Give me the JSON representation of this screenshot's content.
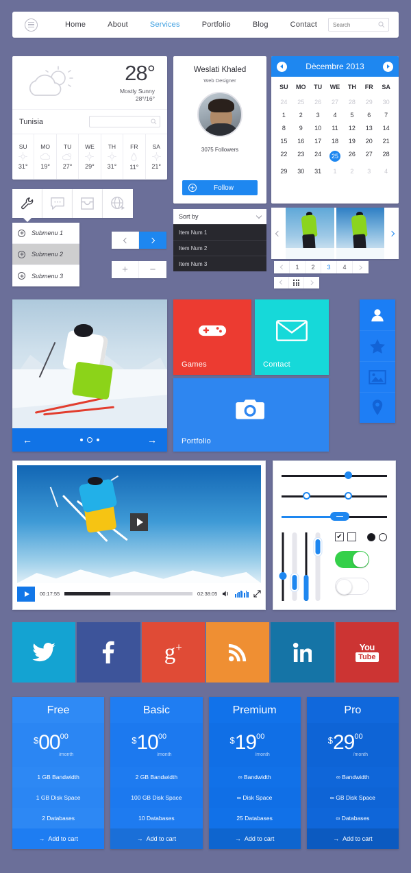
{
  "navbar": {
    "menu_icon": "hamburger-icon",
    "links": [
      {
        "label": "Home",
        "active": false
      },
      {
        "label": "About",
        "active": false
      },
      {
        "label": "Services",
        "active": true
      },
      {
        "label": "Portfolio",
        "active": false
      },
      {
        "label": "Blog",
        "active": false
      },
      {
        "label": "Contact",
        "active": false
      }
    ],
    "search_placeholder": "Search",
    "search_value": ""
  },
  "weather": {
    "icon": "sun-behind-cloud-icon",
    "temperature": "28°",
    "condition": "Mostly Sunny",
    "range": "28°/16°",
    "location": "Tunisia",
    "search_placeholder": "",
    "days": [
      {
        "day": "SU",
        "icon": "sun-icon",
        "temp": "31°"
      },
      {
        "day": "MO",
        "icon": "cloud-icon",
        "temp": "19°"
      },
      {
        "day": "TU",
        "icon": "sun-cloud-icon",
        "temp": "27°"
      },
      {
        "day": "WE",
        "icon": "sun-icon",
        "temp": "29°"
      },
      {
        "day": "TH",
        "icon": "sun-icon",
        "temp": "31°"
      },
      {
        "day": "FR",
        "icon": "raindrop-icon",
        "temp": "11°"
      },
      {
        "day": "SA",
        "icon": "sun-icon",
        "temp": "21°"
      }
    ]
  },
  "profile": {
    "name": "Weslati Khaled",
    "role": "Web Designer",
    "followers": "3075 Followers",
    "follow_label": "Follow",
    "avatar": "user-photo"
  },
  "calendar": {
    "title": "Dècembre 2013",
    "prev_icon": "chevron-left-icon",
    "next_icon": "chevron-right-icon",
    "dow": [
      "SU",
      "MO",
      "TU",
      "WE",
      "TH",
      "FR",
      "SA"
    ],
    "weeks": [
      [
        {
          "d": "24",
          "m": true
        },
        {
          "d": "25",
          "m": true
        },
        {
          "d": "26",
          "m": true
        },
        {
          "d": "27",
          "m": true
        },
        {
          "d": "28",
          "m": true
        },
        {
          "d": "29",
          "m": true
        },
        {
          "d": "30",
          "m": true
        }
      ],
      [
        {
          "d": "1"
        },
        {
          "d": "2"
        },
        {
          "d": "3"
        },
        {
          "d": "4"
        },
        {
          "d": "5"
        },
        {
          "d": "6"
        },
        {
          "d": "7"
        }
      ],
      [
        {
          "d": "8"
        },
        {
          "d": "9"
        },
        {
          "d": "10"
        },
        {
          "d": "11"
        },
        {
          "d": "12"
        },
        {
          "d": "13"
        },
        {
          "d": "14"
        }
      ],
      [
        {
          "d": "15"
        },
        {
          "d": "16"
        },
        {
          "d": "17"
        },
        {
          "d": "18"
        },
        {
          "d": "19"
        },
        {
          "d": "20"
        },
        {
          "d": "21"
        }
      ],
      [
        {
          "d": "22"
        },
        {
          "d": "23"
        },
        {
          "d": "24"
        },
        {
          "d": "25",
          "today": true
        },
        {
          "d": "26"
        },
        {
          "d": "27"
        },
        {
          "d": "28"
        }
      ],
      [
        {
          "d": "29"
        },
        {
          "d": "30"
        },
        {
          "d": "31"
        },
        {
          "d": "1",
          "m": true
        },
        {
          "d": "2",
          "m": true
        },
        {
          "d": "3",
          "m": true
        },
        {
          "d": "4",
          "m": true
        }
      ]
    ],
    "selected_day": "25"
  },
  "icon_tabs": [
    {
      "icon": "wrench-icon",
      "active": true
    },
    {
      "icon": "chat-bubble-icon",
      "active": false
    },
    {
      "icon": "inbox-icon",
      "active": false
    },
    {
      "icon": "globe-icon",
      "active": false
    }
  ],
  "submenu": [
    {
      "label": "Submenu 1",
      "hover": false
    },
    {
      "label": "Submenu 2",
      "hover": true
    },
    {
      "label": "Submenu 3",
      "hover": false
    }
  ],
  "arrow_buttons": {
    "prev_icon": "chevron-left-icon",
    "next_icon": "chevron-right-icon"
  },
  "plusminus_buttons": {
    "plus": "+",
    "minus": "−"
  },
  "sort_dropdown": {
    "label": "Sort by",
    "caret_icon": "chevron-down-icon",
    "options": [
      "Item Num 1",
      "Item Num 2",
      "Item Num 3"
    ]
  },
  "thumb_carousel": {
    "prev_icon": "chevron-left-icon",
    "next_icon": "chevron-right-icon",
    "slides": [
      "snowboarder-green-1",
      "snowboarder-green-2"
    ]
  },
  "pagination": {
    "prev": "‹",
    "pages": [
      "1",
      "2",
      "3",
      "4"
    ],
    "active_page": "3",
    "next": "›"
  },
  "pager_secondary": {
    "prev": "‹",
    "grid_icon": "grid-icon",
    "next": "›"
  },
  "hero_slider": {
    "image": "skier-green-pants",
    "prev_icon": "arrow-left-icon",
    "next_icon": "arrow-right-icon",
    "dots": 3,
    "active_dot": 2
  },
  "tiles": [
    {
      "label": "Games",
      "icon": "gamepad-icon",
      "color": "#ec3b31"
    },
    {
      "label": "Contact",
      "icon": "envelope-icon",
      "color": "#16d9d9"
    },
    {
      "label": "Portfolio",
      "icon": "camera-icon",
      "color": "#2e86f0"
    }
  ],
  "side_strip": [
    {
      "icon": "user-icon",
      "active": true
    },
    {
      "icon": "star-icon",
      "active": false
    },
    {
      "icon": "image-icon",
      "active": false
    },
    {
      "icon": "location-pin-icon",
      "active": false
    }
  ],
  "video": {
    "poster": "skier-jump-blue-sky",
    "big_play_icon": "play-icon",
    "play_icon": "play-icon",
    "current_time": "00:17:55",
    "duration": "02:38:05",
    "progress_percent": 36,
    "volume_icon": "speaker-icon",
    "volume_bars": 8,
    "fullscreen_icon": "expand-icon"
  },
  "slider_panel": {
    "h_sliders": [
      {
        "type": "single",
        "value": 62
      },
      {
        "type": "range",
        "low": 22,
        "high": 62
      },
      {
        "type": "pill",
        "value": 52
      }
    ],
    "v_sliders": [
      {
        "style": "dark-rail",
        "value": 35
      },
      {
        "style": "light-rail",
        "value": 33
      },
      {
        "style": "dark-fill",
        "value": 38
      },
      {
        "style": "light-fill",
        "value": 72
      }
    ],
    "checkbox_checked": {
      "checked": true,
      "glyph": "✔"
    },
    "checkbox_unchecked": {
      "checked": false
    },
    "radio_on": true,
    "radio_off": false,
    "toggle_on": true,
    "toggle_off": false
  },
  "social": [
    {
      "name": "twitter",
      "glyph": "twitter-bird-icon",
      "color": "#14a3d2"
    },
    {
      "name": "facebook",
      "glyph": "facebook-f-icon",
      "color": "#3d549a"
    },
    {
      "name": "google-plus",
      "glyph": "google-plus-icon",
      "color": "#e04b36"
    },
    {
      "name": "rss",
      "glyph": "rss-icon",
      "color": "#ef8f33"
    },
    {
      "name": "linkedin",
      "glyph": "linkedin-in-icon",
      "color": "#1574a6"
    },
    {
      "name": "youtube",
      "glyph": "youtube-icon",
      "color": "#cc3433"
    }
  ],
  "pricing": [
    {
      "name": "Free",
      "currency": "$",
      "amount": "00",
      "cents": "00",
      "period": "/month",
      "features": [
        "1 GB Bandwidth",
        "1 GB Disk Space",
        "2 Databases"
      ],
      "cta": "Add to cart",
      "cta_icon": "arrow-right-icon",
      "header_bg": "#2f8af5",
      "body_bg": "#2b86f3",
      "row_bg": "#2d88f4",
      "cta_bg": "#1e7df2"
    },
    {
      "name": "Basic",
      "currency": "$",
      "amount": "10",
      "cents": "00",
      "period": "/month",
      "features": [
        "2 GB Bandwidth",
        "100 GB Disk Space",
        "10 Databases"
      ],
      "cta": "Add to cart",
      "cta_icon": "arrow-right-icon",
      "header_bg": "#1f7df2",
      "body_bg": "#1c79ef",
      "row_bg": "#1e7bf0",
      "cta_bg": "#1a6fd8"
    },
    {
      "name": "Premium",
      "currency": "$",
      "amount": "19",
      "cents": "00",
      "period": "/month",
      "features": [
        "∞ Bandwidth",
        "∞ Disk Space",
        "25 Databases"
      ],
      "cta": "Add to cart",
      "cta_icon": "arrow-right-icon",
      "header_bg": "#1172ea",
      "body_bg": "#106fe6",
      "row_bg": "#1171e8",
      "cta_bg": "#0e65cf"
    },
    {
      "name": "Pro",
      "currency": "$",
      "amount": "29",
      "cents": "00",
      "period": "/month",
      "features": [
        "∞ Bandwidth",
        "∞ GB Disk Space",
        "∞ Databases"
      ],
      "cta": "Add to cart",
      "cta_icon": "arrow-right-icon",
      "header_bg": "#1068dc",
      "body_bg": "#0e64d6",
      "row_bg": "#0f66d9",
      "cta_bg": "#0c5ac0"
    }
  ],
  "theme": {
    "page_bg": "#6b6f99",
    "accent_blue": "#1e87f0",
    "dark": "#28282e"
  }
}
